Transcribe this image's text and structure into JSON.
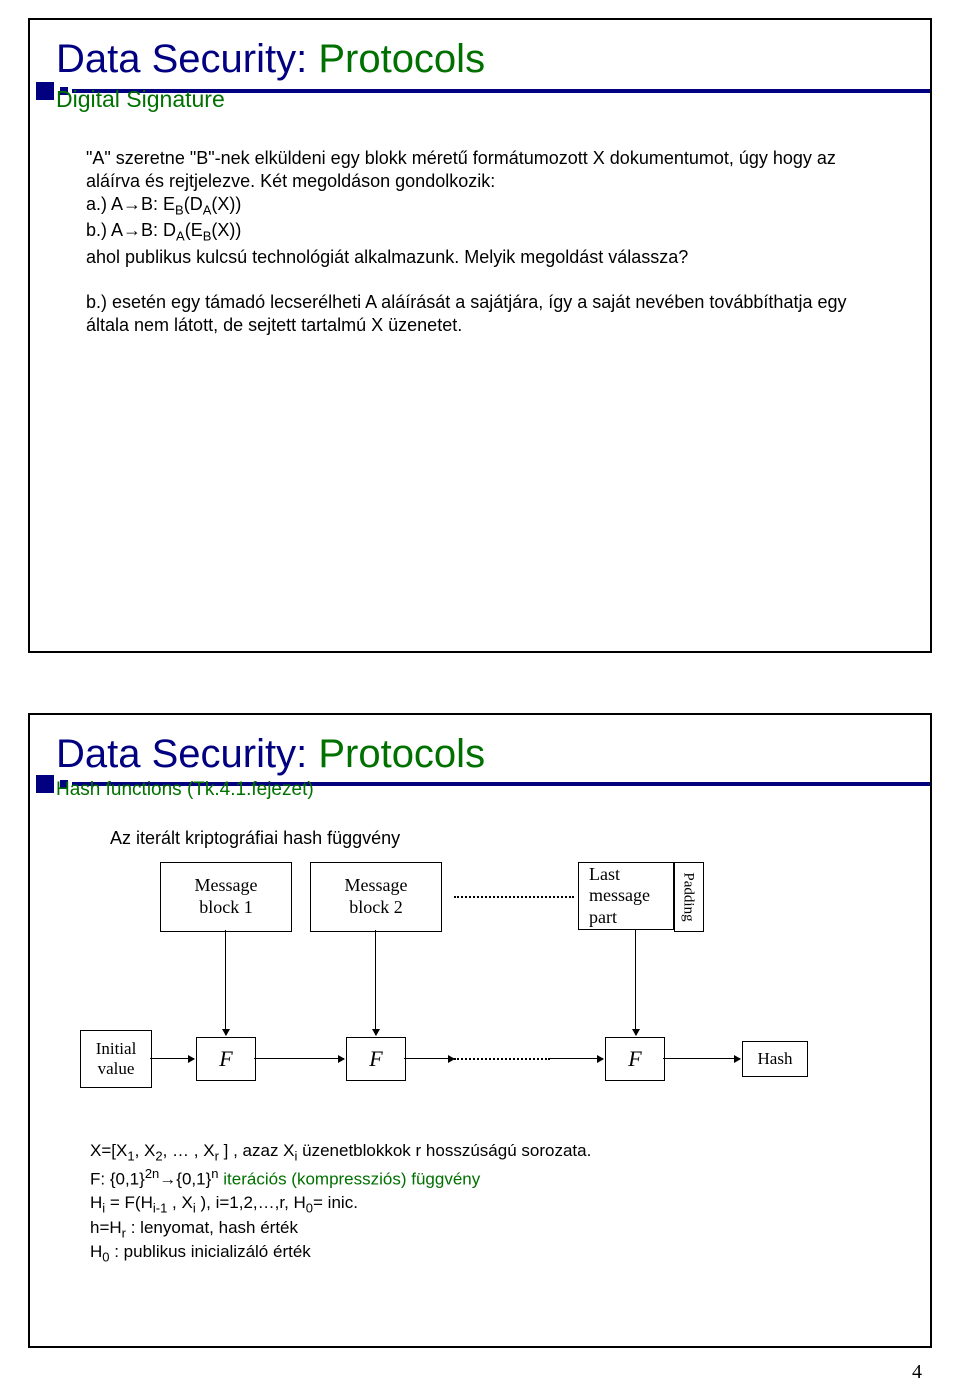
{
  "page_number": "4",
  "slide1": {
    "title_part1": "Data Security: ",
    "title_part2": "Protocols",
    "subtitle": "Digital Signature",
    "intro": "\"A\" szeretne \"B\"-nek elküldeni egy blokk méretű formátumozott X dokumentumot, úgy hogy az aláírva és rejtjelezve. Két megoldáson gondolkozik:",
    "line_a": "a.) A→B: E_B(D_A(X))",
    "line_b": "b.) A→B: D_A(E_B(X))",
    "line_tech": "ahol publikus kulcsú technológiát alkalmazunk. Melyik megoldást válassza?",
    "answer": "b.) esetén egy támadó lecserélheti A aláírását a sajátjára, így a saját nevében továbbíthatja egy általa nem látott, de sejtett tartalmú X üzenetet."
  },
  "slide2": {
    "title_part1": "Data Security: ",
    "title_part2": "Protocols",
    "subtitle": "Hash functions (Tk.4.1.fejezet)",
    "intro": "Az iterált kriptográfiai hash függvény",
    "diagram": {
      "msg1_l1": "Message",
      "msg1_l2": "block 1",
      "msg2_l1": "Message",
      "msg2_l2": "block 2",
      "last_l1": "Last",
      "last_l2": "message",
      "last_l3": "part",
      "padding": "Padding",
      "F": "F",
      "iv_l1": "Initial",
      "iv_l2": "value",
      "hash": "Hash"
    },
    "b1": "X=[X_1, X_2, … , X_r ] , azaz X_i  üzenetblokkok r hosszúságú sorozata.",
    "b2_prefix": "F: {0,1}^2n→{0,1}^n ",
    "b2_green": "iterációs (kompressziós) függvény",
    "b3": "H_i = F(H_{i-1} , X_i ), i=1,2,…,r, H_0= inic.",
    "b4": "h=H_r : lenyomat, hash érték",
    "b5": "H_0 : publikus inicializáló érték"
  }
}
